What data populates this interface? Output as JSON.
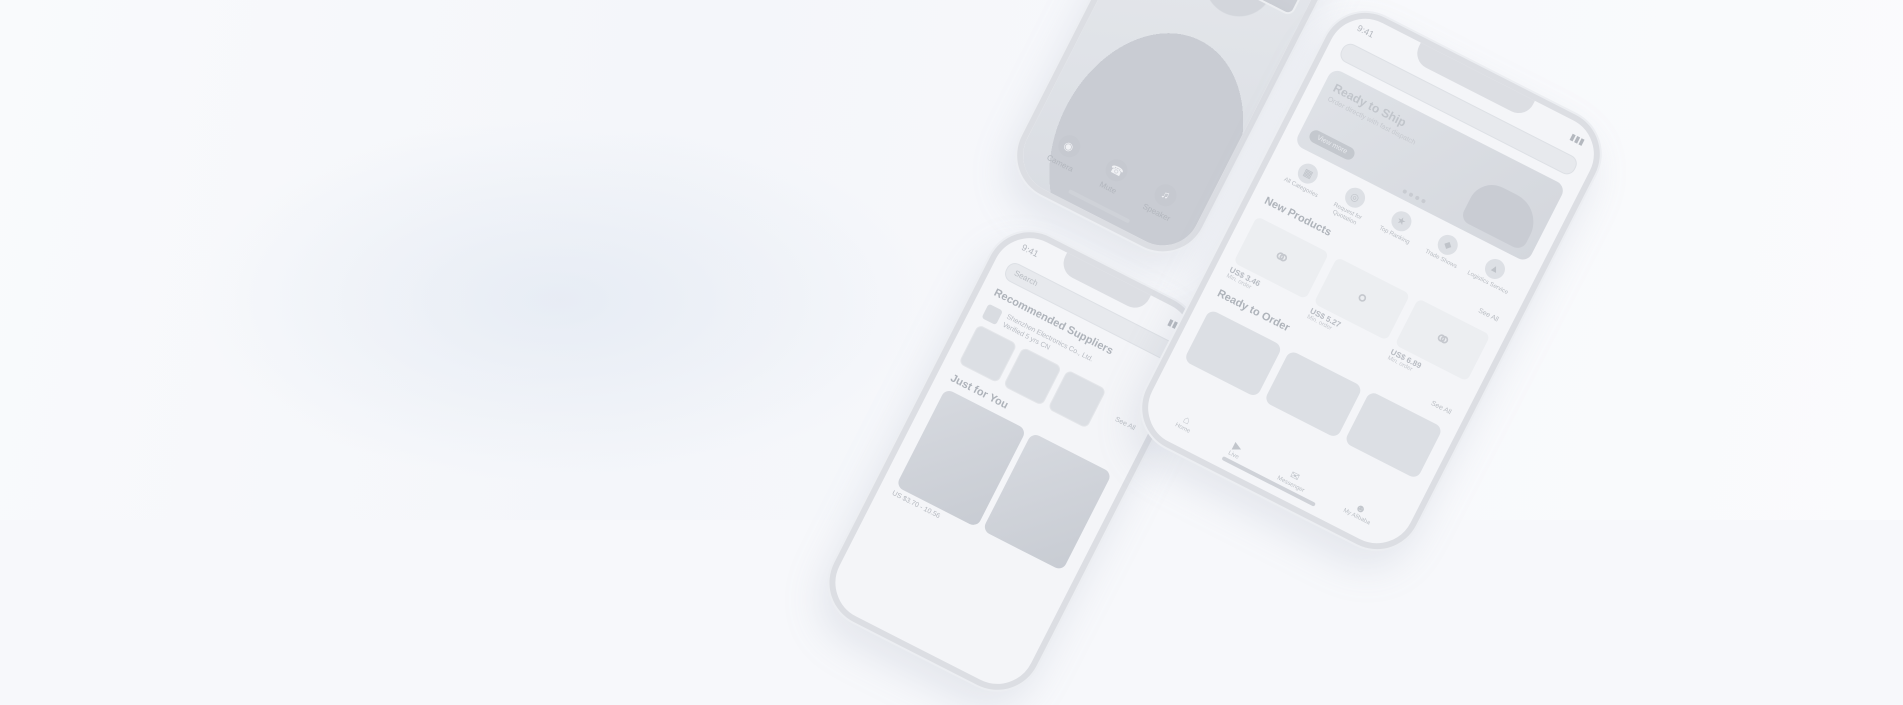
{
  "colors": {
    "background": "#f7f8fb",
    "phone_frame": "#dcdee3",
    "muted_text": "#9aa0a8"
  },
  "phones": {
    "call": {
      "status_time": "",
      "controls": [
        {
          "icon": "camera-icon",
          "label": "Camera"
        },
        {
          "icon": "hang-up-icon",
          "label": "Mute"
        },
        {
          "icon": "speaker-icon",
          "label": "Speaker"
        }
      ]
    },
    "suppliers": {
      "status_time": "9:41",
      "search_placeholder": "Search",
      "section_title": "Recommended Suppliers",
      "supplier_line_1": "Shenzhen Electronics Co., Ltd.",
      "supplier_line_2": "Verified 5 yrs CN",
      "see_all": "See All",
      "section_title_2": "Just for You",
      "price_line": "US $3.70 - 10.56"
    },
    "home": {
      "status_time": "9:41",
      "banner_title": "Ready to Ship",
      "banner_subtitle": "Order directly with fast dispatch",
      "banner_button": "View more",
      "categories": [
        {
          "icon": "grid-icon",
          "label": "All Categories"
        },
        {
          "icon": "globe-icon",
          "label": "Request for Quotation"
        },
        {
          "icon": "star-icon",
          "label": "Top Ranking"
        },
        {
          "icon": "tag-icon",
          "label": "Trade Shows"
        },
        {
          "icon": "shield-icon",
          "label": "Logistics Service"
        }
      ],
      "new_products_title": "New Products",
      "see_all": "See All",
      "products": [
        {
          "icon": "headphones-icon",
          "price": "US$ 3.46",
          "sub": "Min. order"
        },
        {
          "icon": "earbuds-icon",
          "price": "US$ 5.27",
          "sub": "Min. order"
        },
        {
          "icon": "headset-icon",
          "price": "US$ 6.89",
          "sub": "Min. order"
        }
      ],
      "ready_title": "Ready to Order",
      "tabs": [
        {
          "icon": "home-icon",
          "label": "Home"
        },
        {
          "icon": "play-icon",
          "label": "Live"
        },
        {
          "icon": "message-icon",
          "label": "Messenger"
        },
        {
          "icon": "user-icon",
          "label": "My Alibaba"
        }
      ]
    }
  }
}
